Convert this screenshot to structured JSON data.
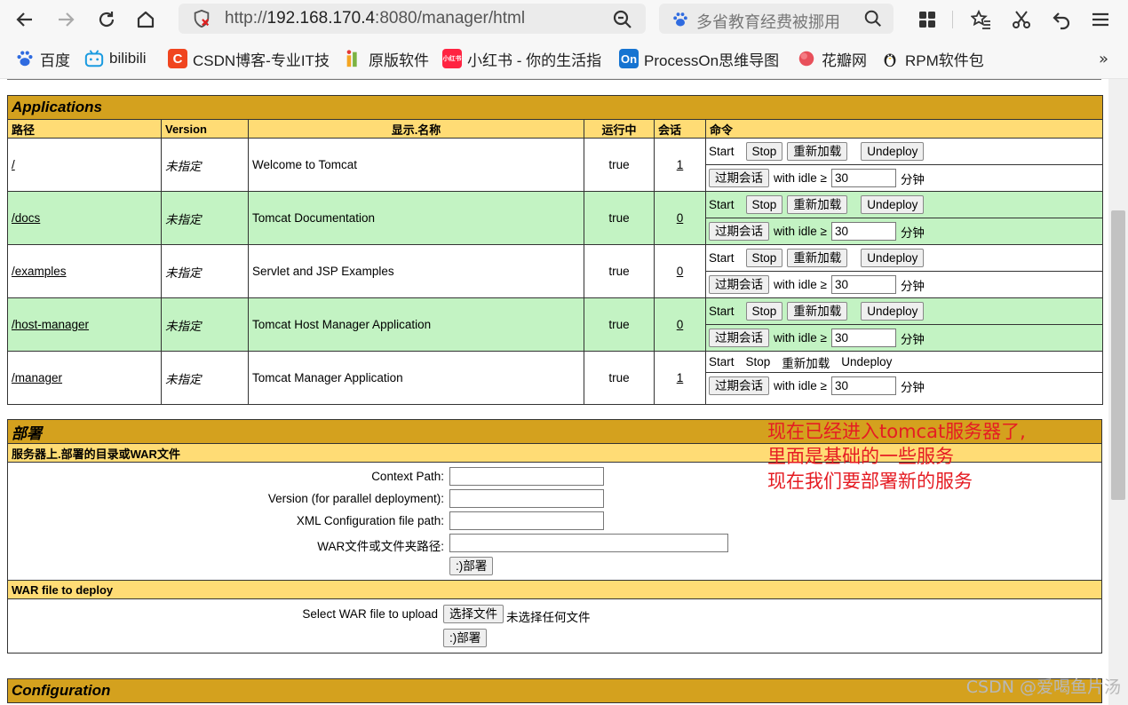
{
  "browser": {
    "url_prefix": "http://",
    "url_host": "192.168.170.4",
    "url_rest": ":8080/manager/html",
    "search_placeholder": "多省教育经费被挪用",
    "bookmarks": [
      {
        "label": "百度",
        "icon": "baidu-icon"
      },
      {
        "label": "bilibili",
        "icon": "bilibili-icon"
      },
      {
        "label": "CSDN博客-专业IT技",
        "icon": "csdn-icon"
      },
      {
        "label": "原版软件",
        "icon": "software-icon"
      },
      {
        "label": "小红书 - 你的生活指",
        "icon": "xiaohongshu-icon"
      },
      {
        "label": "ProcessOn思维导图",
        "icon": "processon-icon"
      },
      {
        "label": "花瓣网",
        "icon": "huaban-icon"
      },
      {
        "label": "RPM软件包",
        "icon": "linux-icon"
      }
    ],
    "more": "»"
  },
  "applications": {
    "title": "Applications",
    "headers": {
      "path": "路径",
      "version": "Version",
      "display_name": "显示.名称",
      "running": "运行中",
      "sessions": "会话",
      "commands": "命令"
    },
    "rows": [
      {
        "path": "/",
        "version": "未指定",
        "name": "Welcome to Tomcat",
        "running": "true",
        "sessions": "1"
      },
      {
        "path": "/docs",
        "version": "未指定",
        "name": "Tomcat Documentation",
        "running": "true",
        "sessions": "0"
      },
      {
        "path": "/examples",
        "version": "未指定",
        "name": "Servlet and JSP Examples",
        "running": "true",
        "sessions": "0"
      },
      {
        "path": "/host-manager",
        "version": "未指定",
        "name": "Tomcat Host Manager Application",
        "running": "true",
        "sessions": "0"
      },
      {
        "path": "/manager",
        "version": "未指定",
        "name": "Tomcat Manager Application",
        "running": "true",
        "sessions": "1"
      }
    ],
    "commands": {
      "start": "Start",
      "stop": "Stop",
      "reload": "重新加载",
      "undeploy": "Undeploy",
      "expire": "过期会话",
      "with_idle": "with idle ≥",
      "idle_value": "30",
      "minutes": "分钟"
    }
  },
  "deploy": {
    "title": "部署",
    "server_section": "服务器上.部署的目录或WAR文件",
    "context_path": "Context Path:",
    "version_label": "Version (for parallel deployment):",
    "xml_config": "XML Configuration file path:",
    "war_dir": "WAR文件或文件夹路径:",
    "deploy_btn": ":)部署",
    "war_section": "WAR file to deploy",
    "select_war": "Select WAR file to upload",
    "choose_file": "选择文件",
    "no_file": "未选择任何文件"
  },
  "configuration": {
    "title": "Configuration"
  },
  "annotation": [
    "现在已经进入tomcat服务器了,",
    "里面是基础的一些服务",
    "现在我们要部署新的服务"
  ],
  "watermark": "CSDN @爱喝鱼片汤"
}
